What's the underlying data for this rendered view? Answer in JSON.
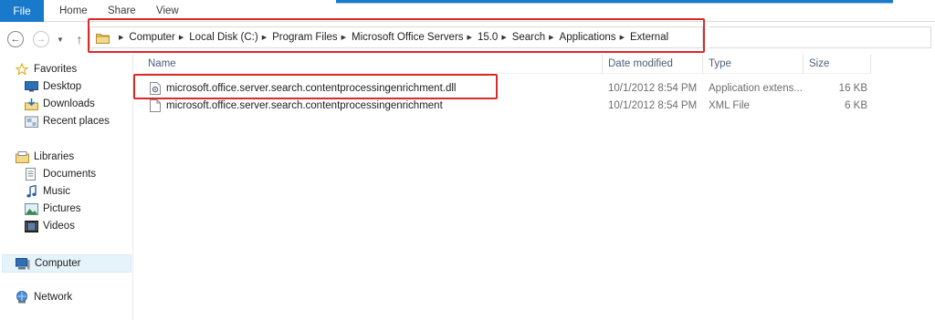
{
  "ribbon": {
    "tabs": [
      {
        "label": "File"
      },
      {
        "label": "Home"
      },
      {
        "label": "Share"
      },
      {
        "label": "View"
      }
    ]
  },
  "breadcrumb": {
    "segments": [
      "Computer",
      "Local Disk (C:)",
      "Program Files",
      "Microsoft Office Servers",
      "15.0",
      "Search",
      "Applications",
      "External"
    ]
  },
  "sidebar": {
    "favorites": {
      "label": "Favorites",
      "icon": "star-icon",
      "items": [
        {
          "label": "Desktop",
          "icon": "desktop-icon"
        },
        {
          "label": "Downloads",
          "icon": "downloads-icon"
        },
        {
          "label": "Recent places",
          "icon": "recent-places-icon"
        }
      ]
    },
    "libraries": {
      "label": "Libraries",
      "icon": "libraries-icon",
      "items": [
        {
          "label": "Documents",
          "icon": "documents-icon"
        },
        {
          "label": "Music",
          "icon": "music-icon"
        },
        {
          "label": "Pictures",
          "icon": "pictures-icon"
        },
        {
          "label": "Videos",
          "icon": "videos-icon"
        }
      ]
    },
    "computer": {
      "label": "Computer",
      "icon": "computer-icon",
      "selected": true
    },
    "network": {
      "label": "Network",
      "icon": "network-icon"
    }
  },
  "columns": {
    "name": "Name",
    "date": "Date modified",
    "type": "Type",
    "size": "Size"
  },
  "files": [
    {
      "name": "microsoft.office.server.search.contentprocessingenrichment.dll",
      "date": "10/1/2012 8:54 PM",
      "type": "Application extens...",
      "size": "16 KB",
      "icon": "dll-file-icon"
    },
    {
      "name": "microsoft.office.server.search.contentprocessingenrichment",
      "date": "10/1/2012 8:54 PM",
      "type": "XML File",
      "size": "6 KB",
      "icon": "xml-file-icon"
    }
  ],
  "colors": {
    "accent": "#1979ca",
    "highlight_box": "#d92a2a",
    "selection": "#e5f3fb"
  }
}
